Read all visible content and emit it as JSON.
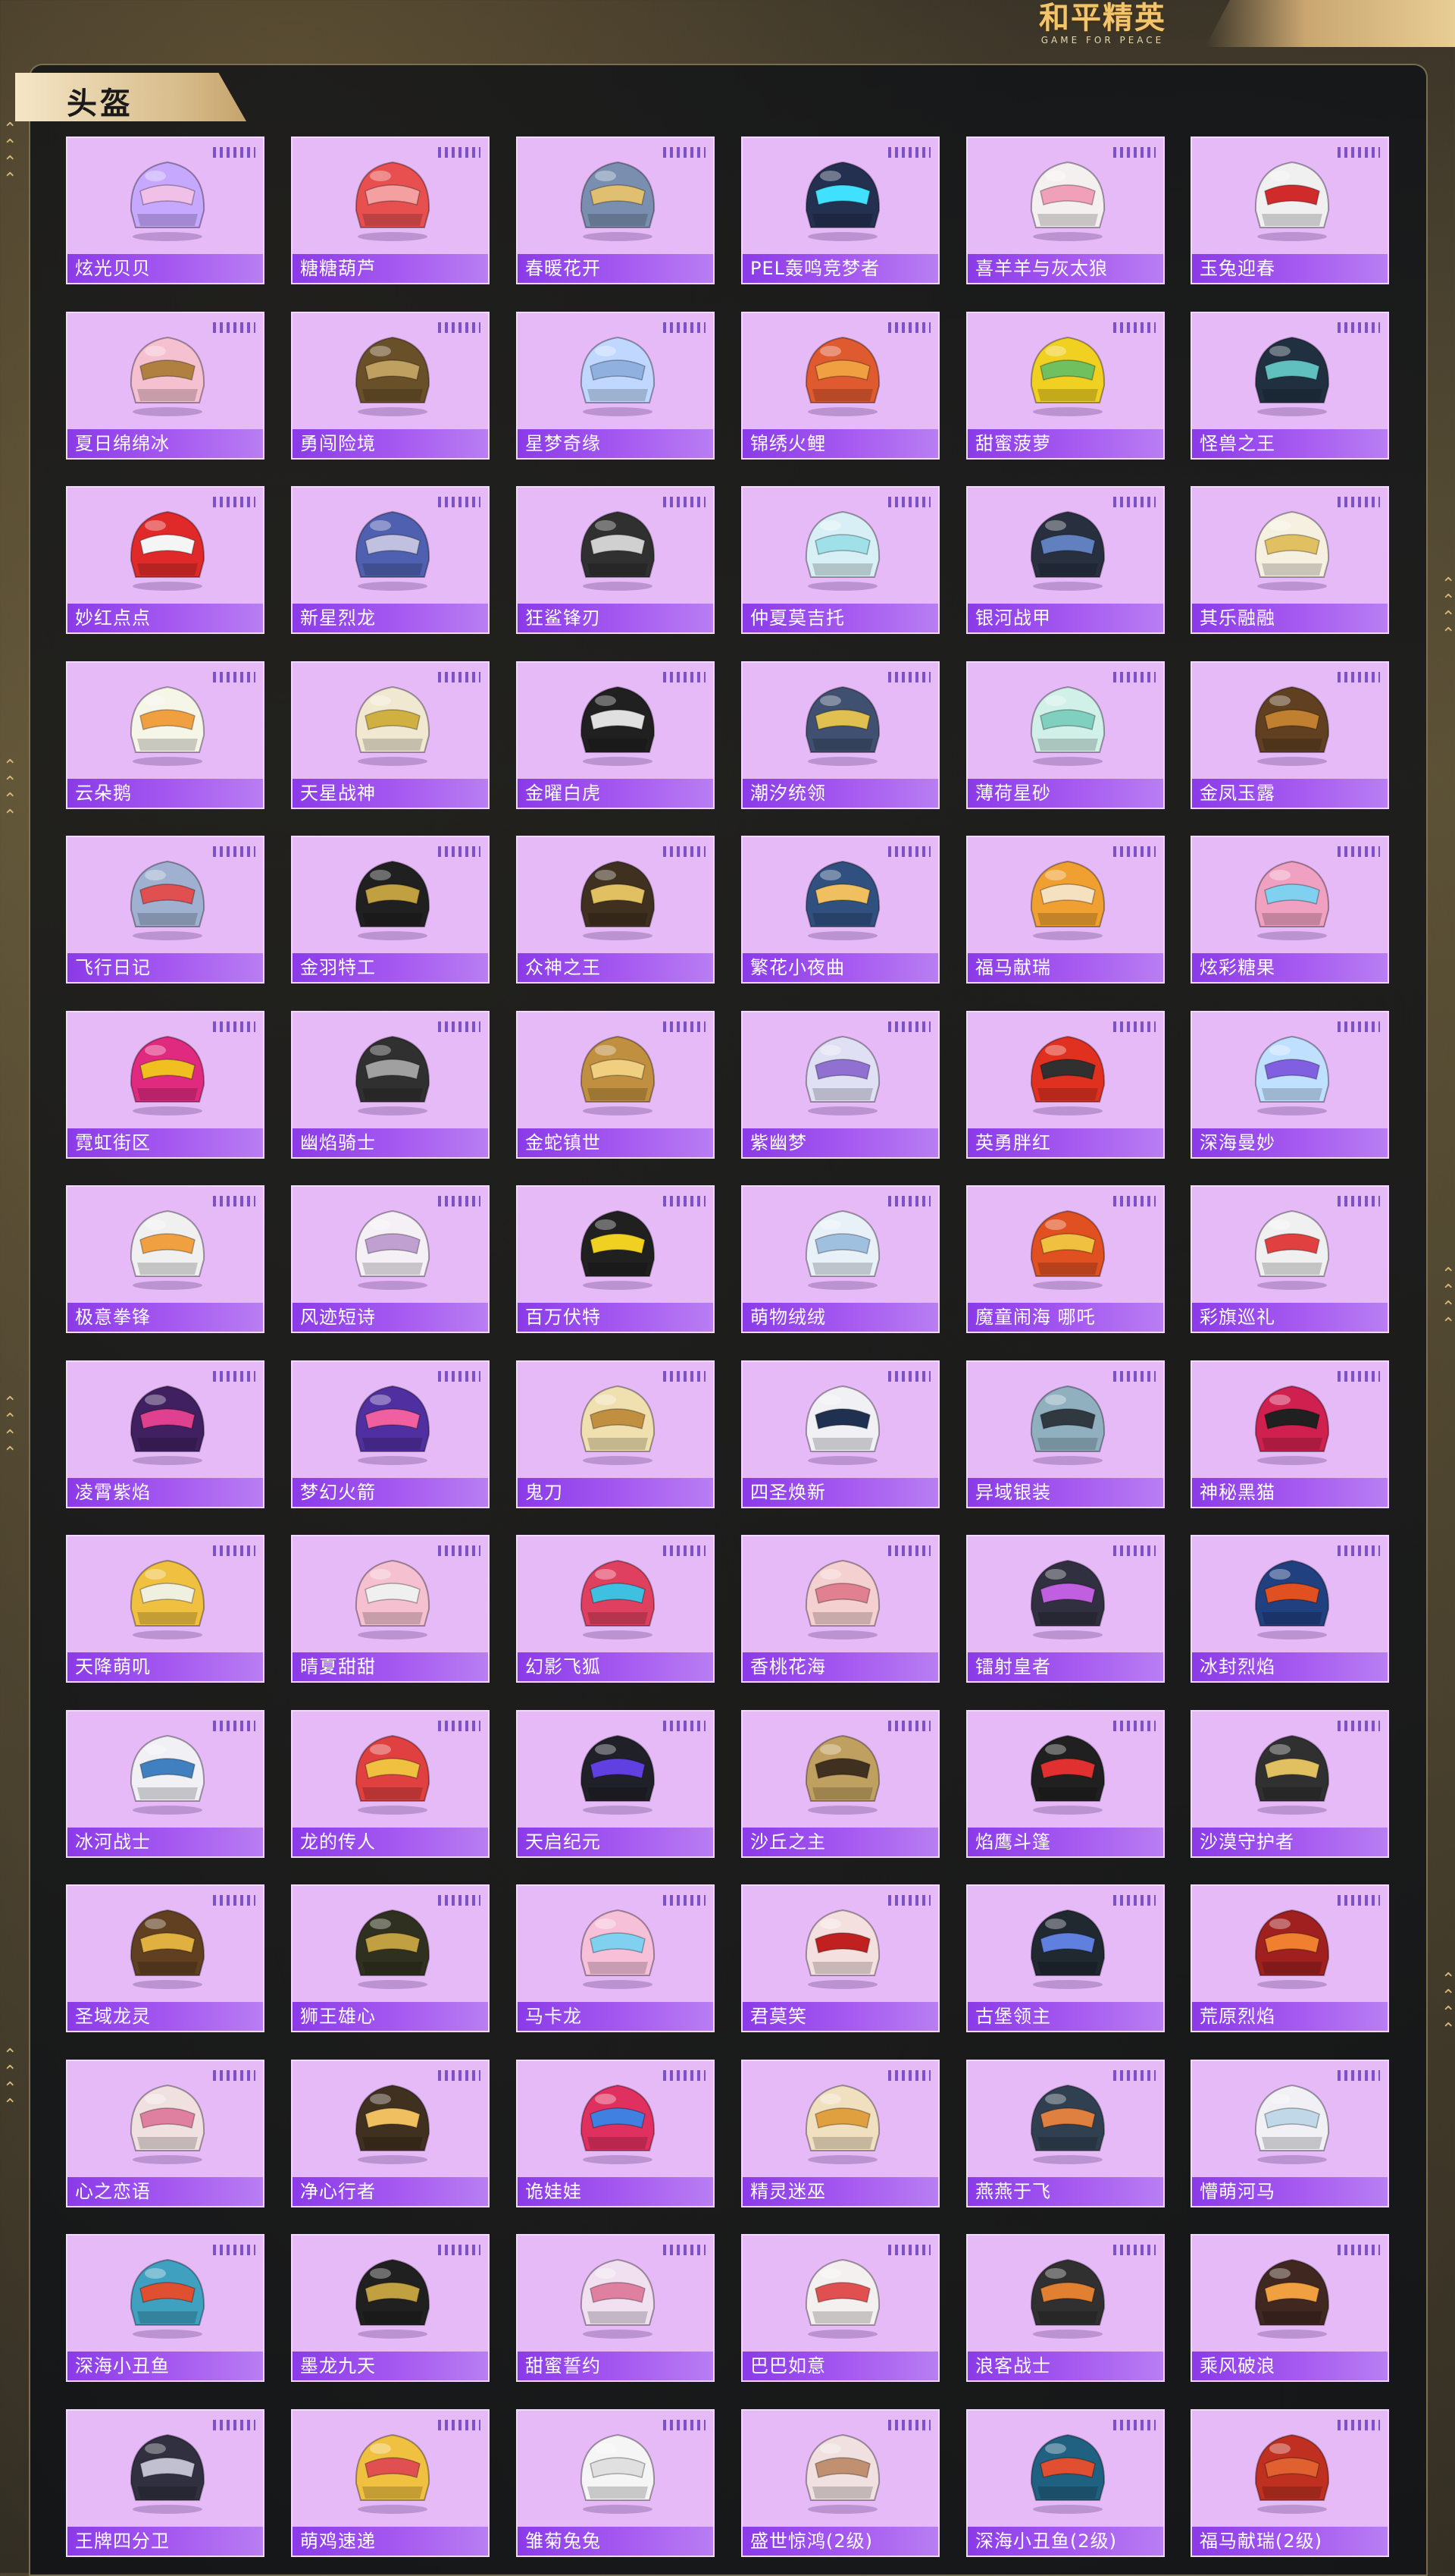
{
  "brand": {
    "name_cn": "和平精英",
    "name_en": "GAME FOR PEACE"
  },
  "section": {
    "title": "头盔"
  },
  "colors": {
    "card_bg": "#e6baf7",
    "label_bar": "#8a3be8",
    "accent_gold": "#d8bd8c"
  },
  "helmets": [
    "炫光贝贝",
    "糖糖葫芦",
    "春暖花开",
    "PEL轰鸣竞梦者",
    "喜羊羊与灰太狼",
    "玉兔迎春",
    "夏日绵绵冰",
    "勇闯险境",
    "星梦奇缘",
    "锦绣火鲤",
    "甜蜜菠萝",
    "怪兽之王",
    "妙红点点",
    "新星烈龙",
    "狂鲨锋刃",
    "仲夏莫吉托",
    "银河战甲",
    "其乐融融",
    "云朵鹅",
    "天星战神",
    "金曜白虎",
    "潮汐统领",
    "薄荷星砂",
    "金凤玉露",
    "飞行日记",
    "金羽特工",
    "众神之王",
    "繁花小夜曲",
    "福马献瑞",
    "炫彩糖果",
    "霓虹街区",
    "幽焰骑士",
    "金蛇镇世",
    "紫幽梦",
    "英勇胖红",
    "深海曼妙",
    "极意拳锋",
    "风迹短诗",
    "百万伏特",
    "萌物绒绒",
    "魔童闹海 哪吒",
    "彩旗巡礼",
    "凌霄紫焰",
    "梦幻火箭",
    "鬼刀",
    "四圣焕新",
    "异域银装",
    "神秘黑猫",
    "天降萌叽",
    "晴夏甜甜",
    "幻影飞狐",
    "香桃花海",
    "镭射皇者",
    "冰封烈焰",
    "冰河战士",
    "龙的传人",
    "天启纪元",
    "沙丘之主",
    "焰鹰斗篷",
    "沙漠守护者",
    "圣域龙灵",
    "狮王雄心",
    "马卡龙",
    "君莫笑",
    "古堡领主",
    "荒原烈焰",
    "心之恋语",
    "净心行者",
    "诡娃娃",
    "精灵迷巫",
    "燕燕于飞",
    "懵萌河马",
    "深海小丑鱼",
    "墨龙九天",
    "甜蜜誓约",
    "巴巴如意",
    "浪客战士",
    "乘风破浪",
    "王牌四分卫",
    "萌鸡速递",
    "雏菊兔兔",
    "盛世惊鸿(2级)",
    "深海小丑鱼(2级)",
    "福马献瑞(2级)"
  ],
  "helmet_palette": [
    [
      "#c7a8ff",
      "#f0c0e8"
    ],
    [
      "#e85050",
      "#f5a0a0"
    ],
    [
      "#7a8fb0",
      "#e0c070"
    ],
    [
      "#243050",
      "#40e0ff"
    ],
    [
      "#f5f0f0",
      "#f0a0b8"
    ],
    [
      "#f0f0f0",
      "#d02a2a"
    ],
    [
      "#f5c0d0",
      "#b08040"
    ],
    [
      "#6a5028",
      "#c0a060"
    ],
    [
      "#c0d8ff",
      "#90b0e0"
    ],
    [
      "#e05a30",
      "#f0a040"
    ],
    [
      "#f0d020",
      "#70c060"
    ],
    [
      "#203040",
      "#60c0c0"
    ],
    [
      "#e02a2a",
      "#f5f5f5"
    ],
    [
      "#5060b0",
      "#c0c0e0"
    ],
    [
      "#303030",
      "#d0d0d0"
    ],
    [
      "#d8f0f5",
      "#a0e0e8"
    ],
    [
      "#283040",
      "#6080c0"
    ],
    [
      "#f5f0e0",
      "#e0c060"
    ],
    [
      "#f5f5e8",
      "#f0a040"
    ],
    [
      "#f0e8d0",
      "#d0b040"
    ],
    [
      "#202020",
      "#e0e0e0"
    ],
    [
      "#405070",
      "#e0c050"
    ],
    [
      "#d0f0e8",
      "#80d0c0"
    ],
    [
      "#604020",
      "#c08030"
    ],
    [
      "#a0b0d0",
      "#e05050"
    ],
    [
      "#202020",
      "#c0a040"
    ],
    [
      "#403020",
      "#e0c060"
    ],
    [
      "#305080",
      "#f0c060"
    ],
    [
      "#f0a030",
      "#f5e0c0"
    ],
    [
      "#f0a0c0",
      "#80d0f0"
    ],
    [
      "#e02a80",
      "#f0c020"
    ],
    [
      "#303030",
      "#a0a0a0"
    ],
    [
      "#c09040",
      "#f0d080"
    ],
    [
      "#e0e0f5",
      "#9070d0"
    ],
    [
      "#e03020",
      "#303030"
    ],
    [
      "#c0e0ff",
      "#8060e0"
    ],
    [
      "#f0f0f0",
      "#f0a040"
    ],
    [
      "#f5f0f5",
      "#c0a0d0"
    ],
    [
      "#202020",
      "#f0d020"
    ],
    [
      "#e8f0f8",
      "#a0c0e0"
    ],
    [
      "#e05020",
      "#f0c040"
    ],
    [
      "#f0f0f0",
      "#e04040"
    ],
    [
      "#402060",
      "#e04090"
    ],
    [
      "#5030a0",
      "#f060a0"
    ],
    [
      "#f0e0b0",
      "#c09040"
    ],
    [
      "#f0f0f5",
      "#203050"
    ],
    [
      "#90b0c0",
      "#303840"
    ],
    [
      "#d02050",
      "#202020"
    ],
    [
      "#f0c040",
      "#f0f0e0"
    ],
    [
      "#f5c0d0",
      "#f0f0f0"
    ],
    [
      "#e04060",
      "#40c0e0"
    ],
    [
      "#f5d0d0",
      "#e08090"
    ],
    [
      "#303040",
      "#c060e0"
    ],
    [
      "#204080",
      "#e05020"
    ],
    [
      "#f0f0f5",
      "#4080c0"
    ],
    [
      "#e04040",
      "#f0c040"
    ],
    [
      "#202028",
      "#6040e0"
    ],
    [
      "#c0a060",
      "#403020"
    ],
    [
      "#202020",
      "#e03030"
    ],
    [
      "#303030",
      "#e0c060"
    ],
    [
      "#604020",
      "#e0b040"
    ],
    [
      "#303020",
      "#c0a040"
    ],
    [
      "#f5c0d8",
      "#80d0f0"
    ],
    [
      "#f5e0e0",
      "#c02020"
    ],
    [
      "#202830",
      "#6080e0"
    ],
    [
      "#a02020",
      "#f08030"
    ],
    [
      "#f0e0e0",
      "#e080a0"
    ],
    [
      "#403020",
      "#f0c060"
    ],
    [
      "#e03060",
      "#4080e0"
    ],
    [
      "#f0e0c0",
      "#e0a040"
    ],
    [
      "#304050",
      "#e08040"
    ],
    [
      "#f0f0f5",
      "#c0d8e8"
    ],
    [
      "#40a0c0",
      "#e05030"
    ],
    [
      "#202020",
      "#c0a040"
    ],
    [
      "#f0e0f0",
      "#e080a0"
    ],
    [
      "#f5f0f0",
      "#e05050"
    ],
    [
      "#303030",
      "#e08030"
    ],
    [
      "#402820",
      "#f0a040"
    ],
    [
      "#303040",
      "#c0c0d0"
    ],
    [
      "#f0c040",
      "#e05050"
    ],
    [
      "#f5f5f5",
      "#e0e0e0"
    ],
    [
      "#f0e0e0",
      "#c09070"
    ],
    [
      "#206080",
      "#e05030"
    ],
    [
      "#c03020",
      "#e06030"
    ]
  ]
}
